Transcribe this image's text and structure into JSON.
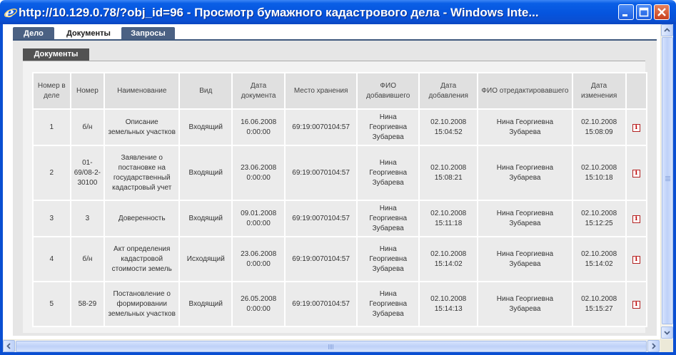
{
  "window": {
    "title": "http://10.129.0.78/?obj_id=96 - Просмотр бумажного кадастрового дела - Windows Inte...",
    "icon": "ie-icon",
    "controls": [
      "minimize-icon",
      "maximize-icon",
      "close-icon"
    ]
  },
  "tabs": [
    {
      "label": "Дело",
      "active": false
    },
    {
      "label": "Документы",
      "active": true
    },
    {
      "label": "Запросы",
      "active": false
    }
  ],
  "section_tab": "Документы",
  "table": {
    "headers": {
      "num": "Номер в деле",
      "number": "Номер",
      "name": "Наименование",
      "kind": "Вид",
      "doc_date": "Дата документа",
      "storage": "Место хранения",
      "added_by": "ФИО добавившего",
      "added_date": "Дата добавления",
      "edited_by": "ФИО отредактировавшего",
      "edited_date": "Дата изменения"
    },
    "rows": [
      {
        "num": "1",
        "number": "б/н",
        "name": "Описание земельных участков",
        "kind": "Входящий",
        "doc_date": "16.06.2008 0:00:00",
        "storage": "69:19:0070104:57",
        "added_by": "Нина Георгиевна Зубарева",
        "added_date": "02.10.2008 15:04:52",
        "edited_by": "Нина Георгиевна Зубарева",
        "edited_date": "02.10.2008 15:08:09"
      },
      {
        "num": "2",
        "number": "01-69/08-2-30100",
        "name": "Заявление о постановке на государственный кадастровый учет",
        "kind": "Входящий",
        "doc_date": "23.06.2008 0:00:00",
        "storage": "69:19:0070104:57",
        "added_by": "Нина Георгиевна Зубарева",
        "added_date": "02.10.2008 15:08:21",
        "edited_by": "Нина Георгиевна Зубарева",
        "edited_date": "02.10.2008 15:10:18"
      },
      {
        "num": "3",
        "number": "3",
        "name": "Доверенность",
        "kind": "Входящий",
        "doc_date": "09.01.2008 0:00:00",
        "storage": "69:19:0070104:57",
        "added_by": "Нина Георгиевна Зубарева",
        "added_date": "02.10.2008 15:11:18",
        "edited_by": "Нина Георгиевна Зубарева",
        "edited_date": "02.10.2008 15:12:25"
      },
      {
        "num": "4",
        "number": "б/н",
        "name": "Акт определения кадастровой стоимости земель",
        "kind": "Исходящий",
        "doc_date": "23.06.2008 0:00:00",
        "storage": "69:19:0070104:57",
        "added_by": "Нина Георгиевна Зубарева",
        "added_date": "02.10.2008 15:14:02",
        "edited_by": "Нина Георгиевна Зубарева",
        "edited_date": "02.10.2008 15:14:02"
      },
      {
        "num": "5",
        "number": "58-29",
        "name": "Постановление о формировании земельных участков",
        "kind": "Входящий",
        "doc_date": "26.05.2008 0:00:00",
        "storage": "69:19:0070104:57",
        "added_by": "Нина Георгиевна Зубарева",
        "added_date": "02.10.2008 15:14:13",
        "edited_by": "Нина Георгиевна Зубарева",
        "edited_date": "02.10.2008 15:15:27"
      }
    ],
    "row_action_icon": "info-icon",
    "row_action_glyph": "i"
  },
  "colors": {
    "titlebar": "#0554de",
    "tab_inactive": "#4b6183",
    "section_tab": "#525252",
    "info_icon": "#c00000"
  }
}
